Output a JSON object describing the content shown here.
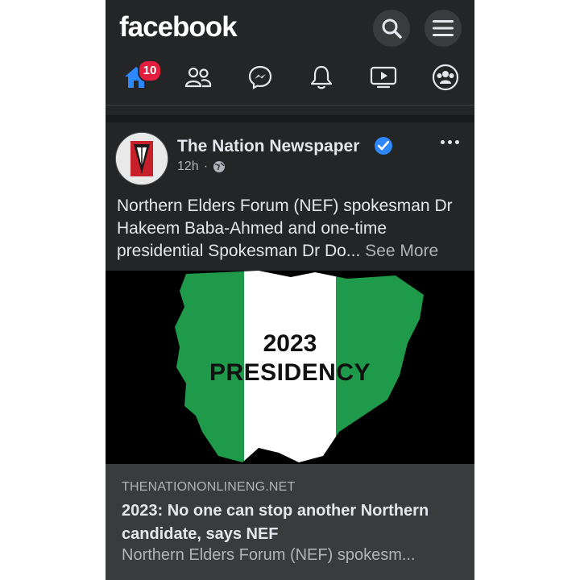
{
  "app": {
    "brand": "facebook"
  },
  "header": {
    "search_icon": "search-icon",
    "menu_icon": "menu-icon"
  },
  "nav": {
    "items": [
      {
        "name": "home",
        "icon": "home-icon",
        "badge": "10",
        "active": true
      },
      {
        "name": "friends",
        "icon": "friends-icon"
      },
      {
        "name": "messenger",
        "icon": "messenger-icon"
      },
      {
        "name": "notifications",
        "icon": "bell-icon"
      },
      {
        "name": "watch",
        "icon": "video-icon"
      },
      {
        "name": "groups",
        "icon": "groups-icon"
      }
    ]
  },
  "post": {
    "page_name": "The Nation Newspaper",
    "verified": true,
    "time": "12h",
    "separator": "·",
    "audience_icon": "globe-icon",
    "caption": "Northern Elders Forum (NEF) spokesman Dr Hakeem Baba-Ahmed and one-time presidential Spokesman Dr Do...",
    "see_more": "See More",
    "image": {
      "line1": "2023",
      "line2": "PRESIDENCY"
    },
    "link": {
      "domain": "THENATIONONLINENG.NET",
      "title": "2023: No one can stop another Northern candidate, says NEF",
      "description": "Northern Elders Forum (NEF) spokesm..."
    }
  },
  "colors": {
    "background": "#242526",
    "accent": "#2d88ff",
    "badge": "#e41e3f",
    "flag_green": "#1f9a4a"
  }
}
